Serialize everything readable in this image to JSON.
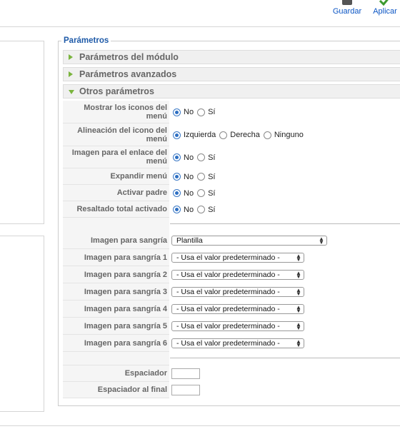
{
  "toolbar": {
    "save_label": "Guardar",
    "apply_label": "Aplicar",
    "icons": {
      "save": "save-icon",
      "apply": "apply-icon"
    }
  },
  "fieldset": {
    "legend": "Parámetros"
  },
  "panels": [
    {
      "title": "Parámetros del módulo",
      "expanded": false
    },
    {
      "title": "Parámetros avanzados",
      "expanded": false
    },
    {
      "title": "Otros parámetros",
      "expanded": true
    }
  ],
  "other_params": {
    "show_icons": {
      "label": "Mostrar los iconos del menú",
      "options": [
        "No",
        "Sí"
      ],
      "selected": "No"
    },
    "icon_align": {
      "label": "Alineación del icono del menú",
      "options": [
        "Izquierda",
        "Derecha",
        "Ninguno"
      ],
      "selected": "Izquierda"
    },
    "link_image": {
      "label": "Imagen para el enlace del menú",
      "options": [
        "No",
        "Sí"
      ],
      "selected": "No"
    },
    "expand_menu": {
      "label": "Expandir menú",
      "options": [
        "No",
        "Sí"
      ],
      "selected": "No"
    },
    "activate_parent": {
      "label": "Activar padre",
      "options": [
        "No",
        "Sí"
      ],
      "selected": "No"
    },
    "full_highlight": {
      "label": "Resaltado total activado",
      "options": [
        "No",
        "Sí"
      ],
      "selected": "No"
    },
    "indent_image": {
      "label": "Imagen para sangría",
      "value": "Plantilla"
    },
    "indent_images": [
      {
        "label": "Imagen para sangría 1",
        "value": "- Usa el valor predeterminado -"
      },
      {
        "label": "Imagen para sangría 2",
        "value": "- Usa el valor predeterminado -"
      },
      {
        "label": "Imagen para sangría 3",
        "value": "- Usa el valor predeterminado -"
      },
      {
        "label": "Imagen para sangría 4",
        "value": "- Usa el valor predeterminado -"
      },
      {
        "label": "Imagen para sangría 5",
        "value": "- Usa el valor predeterminado -"
      },
      {
        "label": "Imagen para sangría 6",
        "value": "- Usa el valor predeterminado -"
      }
    ],
    "spacer": {
      "label": "Espaciador",
      "value": ""
    },
    "end_spacer": {
      "label": "Espaciador al final",
      "value": ""
    }
  },
  "colors": {
    "legend": "#1e5aa8",
    "toolbar_link": "#0b55c4",
    "panel_triangle": "#7ab43d",
    "radio_selected": "#2d6fc3"
  }
}
